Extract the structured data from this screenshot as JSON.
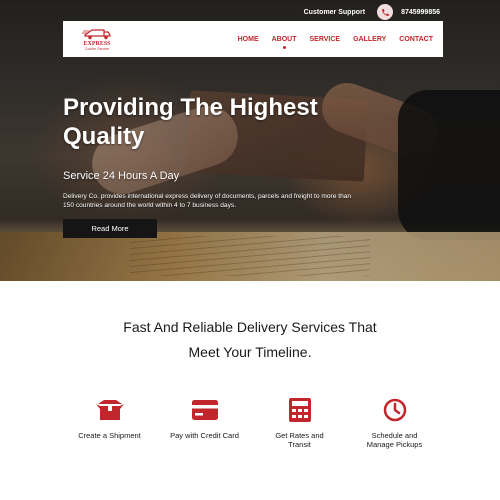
{
  "colors": {
    "brand": "#c0262b",
    "dark": "#151515"
  },
  "topbar": {
    "support_label": "Customer Support",
    "phone_icon": "phone-icon",
    "phone_number": "8745999856"
  },
  "logo": {
    "word": "EXPRESS",
    "tagline": "Courier Service"
  },
  "nav": {
    "items": [
      {
        "label": "HOME"
      },
      {
        "label": "ABOUT",
        "has_dropdown": true
      },
      {
        "label": "SERVICE"
      },
      {
        "label": "GALLERY"
      },
      {
        "label": "CONTACT"
      }
    ]
  },
  "hero": {
    "title": "Providing The Highest Quality",
    "subtitle": "Service 24 Hours A Day",
    "description": "Delivery Co. provides international express delivery of documents, parcels and freight to more than 150 countries around the world within 4 to 7 business days.",
    "cta": "Read More"
  },
  "services": {
    "heading_line1": "Fast And Reliable Delivery Services That",
    "heading_line2": "Meet Your Timeline.",
    "features": [
      {
        "icon": "box-icon",
        "label": "Create a Shipment"
      },
      {
        "icon": "credit-card-icon",
        "label": "Pay with Credit Card"
      },
      {
        "icon": "calculator-icon",
        "label": "Get Rates and Transit"
      },
      {
        "icon": "clock-icon",
        "label": "Schedule and Manage Pickups"
      }
    ]
  }
}
